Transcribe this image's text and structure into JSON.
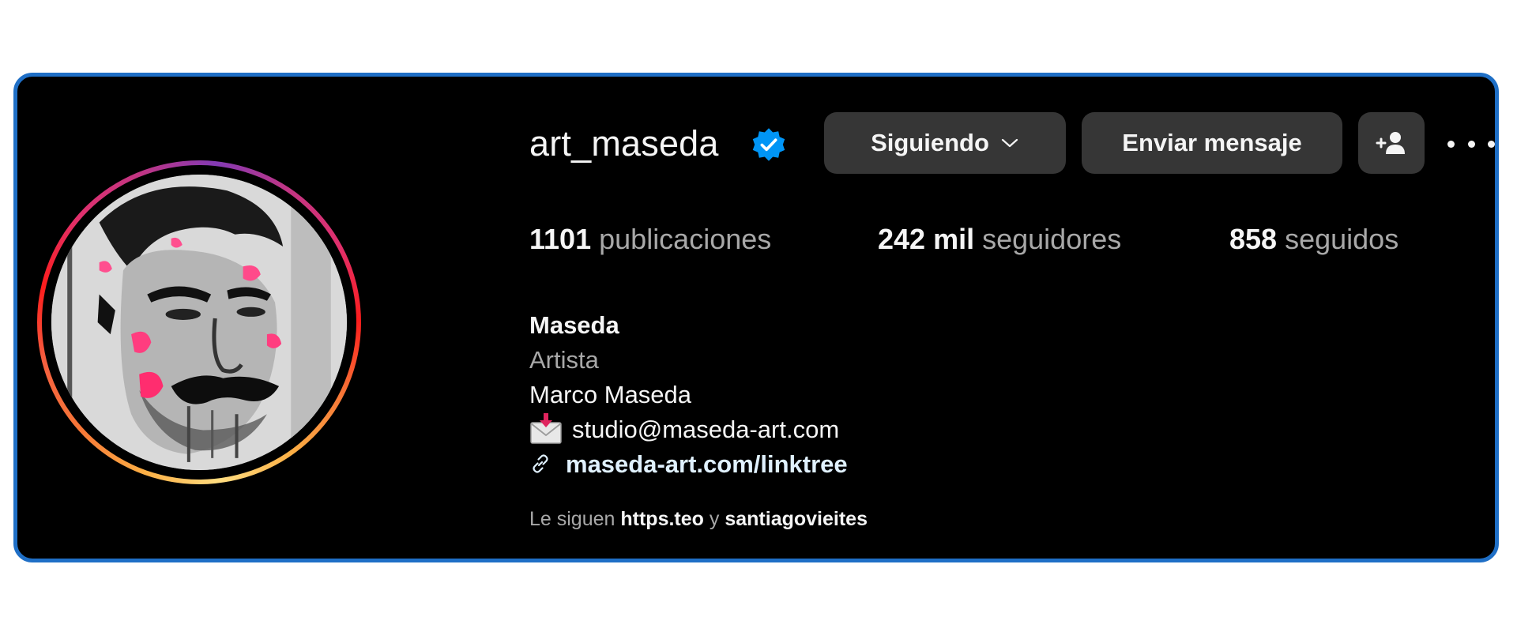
{
  "profile": {
    "username": "art_maseda",
    "verified_icon": "verified-badge-icon",
    "buttons": {
      "following_label": "Siguiendo",
      "message_label": "Enviar mensaje",
      "add_user_icon": "add-user-icon",
      "more_icon": "more-options-icon"
    },
    "stats": {
      "posts_count": "1101",
      "posts_label": "publicaciones",
      "followers_count": "242 mil",
      "followers_label": "seguidores",
      "following_count": "858",
      "following_label": "seguidos"
    },
    "bio": {
      "name": "Maseda",
      "category": "Artista",
      "line1": "Marco Maseda",
      "email": "studio@maseda-art.com",
      "link": "maseda-art.com/linktree"
    },
    "followed_by": {
      "prefix": "Le siguen",
      "user1": "https.teo",
      "conjunction": "y",
      "user2": "santiagovieites"
    }
  },
  "colors": {
    "background": "#000000",
    "frame_border": "#1f6fc6",
    "button_bg": "#363636",
    "verified_blue": "#0095f6",
    "secondary_text": "#a8a8a8",
    "link_text": "#e0f1ff"
  }
}
